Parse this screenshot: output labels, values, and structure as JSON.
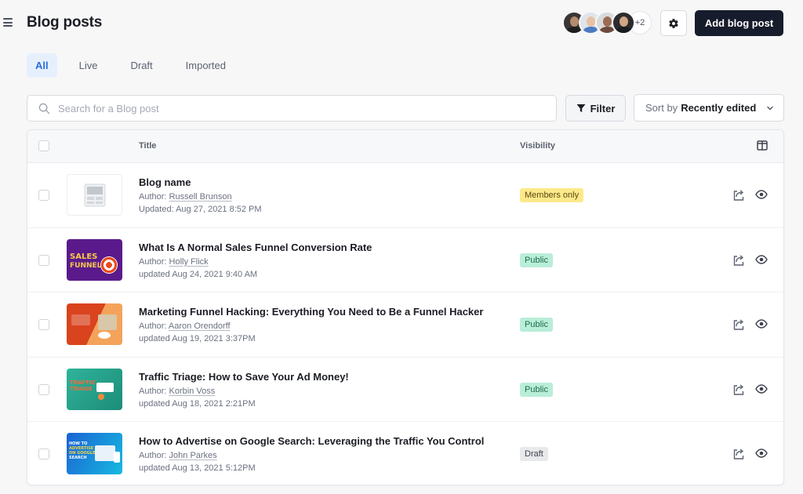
{
  "header": {
    "title": "Blog posts",
    "avatars_more": "+2",
    "add_button": "Add blog post"
  },
  "tabs": [
    {
      "label": "All",
      "active": true
    },
    {
      "label": "Live",
      "active": false
    },
    {
      "label": "Draft",
      "active": false
    },
    {
      "label": "Imported",
      "active": false
    }
  ],
  "toolbar": {
    "search_placeholder": "Search for a Blog post",
    "search_value": "",
    "filter_label": "Filter",
    "sort_prefix": "Sort by",
    "sort_value": "Recently edited"
  },
  "table": {
    "columns": {
      "title": "Title",
      "visibility": "Visibility"
    },
    "rows": [
      {
        "title": "Blog name",
        "author_label": "Author:",
        "author": "Russell Brunson",
        "updated": "Updated: Aug 27, 2021 8:52 PM",
        "visibility": "Members only",
        "visibility_type": "members",
        "thumbnail": "placeholder-image"
      },
      {
        "title": "What Is A Normal Sales Funnel Conversion Rate",
        "author_label": "Author:",
        "author": "Holly Flick",
        "updated": "updated Aug 24, 2021 9:40 AM",
        "visibility": "Public",
        "visibility_type": "public",
        "thumbnail": "sales-funnel-thumbnail"
      },
      {
        "title": "Marketing Funnel Hacking: Everything You Need to Be a Funnel Hacker",
        "author_label": "Author:",
        "author": "Aaron Orendorff",
        "updated": "updated Aug 19, 2021 3:37PM",
        "visibility": "Public",
        "visibility_type": "public",
        "thumbnail": "funnel-hacking-thumbnail"
      },
      {
        "title": "Traffic Triage: How to Save Your Ad Money!",
        "author_label": "Author:",
        "author": "Korbin Voss",
        "updated": "updated Aug 18, 2021 2:21PM",
        "visibility": "Public",
        "visibility_type": "public",
        "thumbnail": "traffic-triage-thumbnail"
      },
      {
        "title": "How to Advertise on Google Search: Leveraging the Traffic You Control",
        "author_label": "Author:",
        "author": "John Parkes",
        "updated": "updated Aug 13, 2021 5:12PM",
        "visibility": "Draft",
        "visibility_type": "draft",
        "thumbnail": "google-search-thumbnail"
      }
    ]
  },
  "thumb_text": {
    "sales": "SALES",
    "funnel": "FUNNEL",
    "traffic": "TRAFFIC",
    "triage": "TRIAGE",
    "howto": "HOW TO",
    "advertise": "ADVERTISE",
    "ongoogle": "ON GOOGLE",
    "search": "SEARCH"
  },
  "colors": {
    "primary_button": "#161c2b",
    "tab_active": "#2a6fd6",
    "badge_members": "#fde98a",
    "badge_public": "#b9eed8",
    "badge_draft": "#e8e9eb"
  }
}
